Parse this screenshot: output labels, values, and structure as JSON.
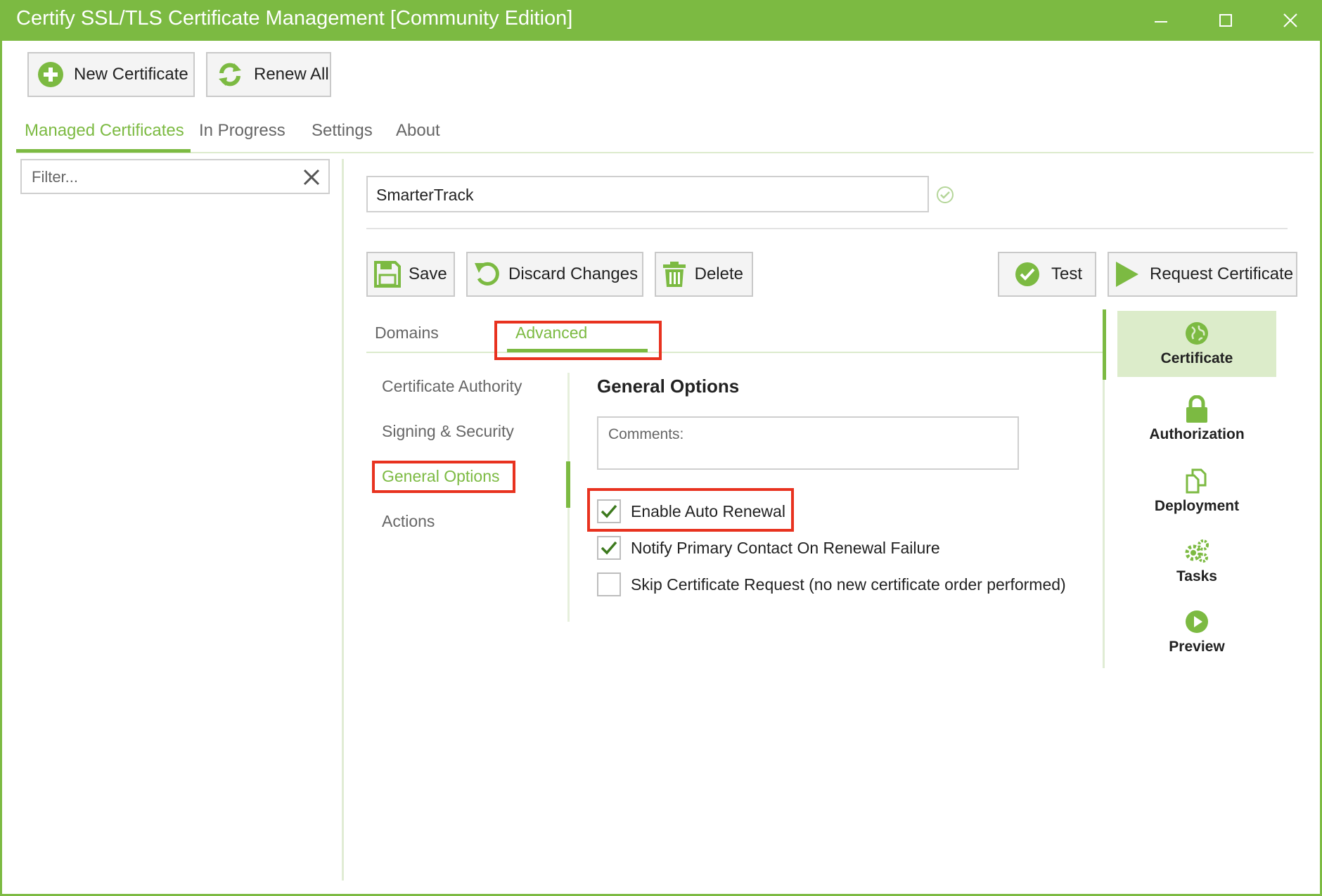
{
  "window": {
    "title": "Certify SSL/TLS Certificate Management [Community Edition]"
  },
  "toolbar": {
    "new_certificate_label": "New Certificate",
    "renew_all_label": "Renew All"
  },
  "main_tabs": [
    {
      "label": "Managed Certificates",
      "active": true
    },
    {
      "label": "In Progress",
      "active": false
    },
    {
      "label": "Settings",
      "active": false
    },
    {
      "label": "About",
      "active": false
    }
  ],
  "filter": {
    "placeholder": "Filter...",
    "value": ""
  },
  "certificate": {
    "name": "SmarterTrack"
  },
  "actions": {
    "save_label": "Save",
    "discard_label": "Discard Changes",
    "delete_label": "Delete",
    "test_label": "Test",
    "request_label": "Request Certificate"
  },
  "sub_tabs": [
    {
      "label": "Domains",
      "active": false
    },
    {
      "label": "Advanced",
      "active": true
    }
  ],
  "advanced_nav": [
    {
      "label": "Certificate Authority",
      "active": false
    },
    {
      "label": "Signing & Security",
      "active": false
    },
    {
      "label": "General Options",
      "active": true
    },
    {
      "label": "Actions",
      "active": false
    }
  ],
  "general_options": {
    "title": "General Options",
    "comments_placeholder": "Comments:",
    "comments_value": "",
    "checkboxes": [
      {
        "label": "Enable Auto Renewal",
        "checked": true
      },
      {
        "label": "Notify Primary Contact On Renewal Failure",
        "checked": true
      },
      {
        "label": "Skip Certificate Request (no new certificate order performed)",
        "checked": false
      }
    ]
  },
  "right_nav": [
    {
      "label": "Certificate",
      "icon": "globe-icon",
      "active": true
    },
    {
      "label": "Authorization",
      "icon": "lock-icon",
      "active": false
    },
    {
      "label": "Deployment",
      "icon": "copy-icon",
      "active": false
    },
    {
      "label": "Tasks",
      "icon": "gears-icon",
      "active": false
    },
    {
      "label": "Preview",
      "icon": "play-icon",
      "active": false
    }
  ],
  "colors": {
    "accent": "#7cba42",
    "highlight_box": "#e8321f",
    "active_nav_bg": "#dcecca"
  }
}
